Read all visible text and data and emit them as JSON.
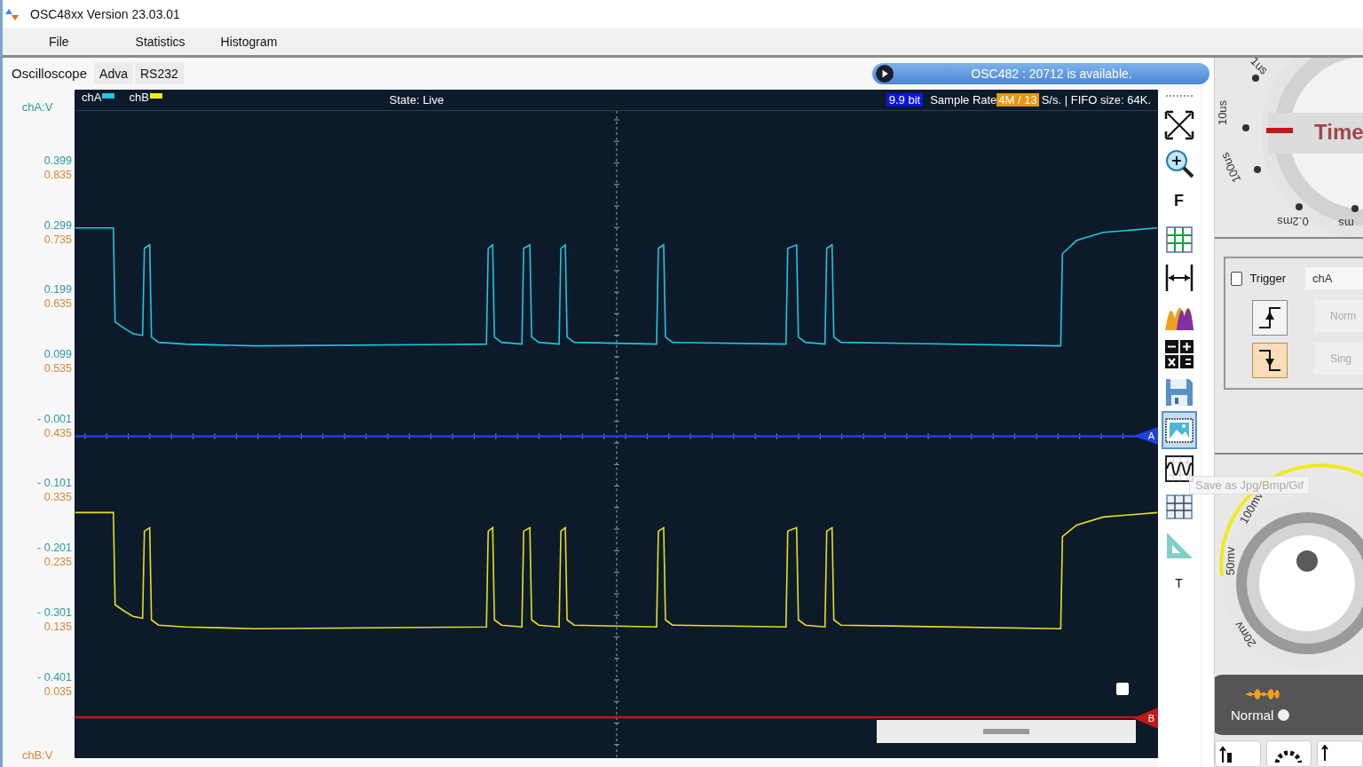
{
  "window": {
    "title": "OSC48xx  Version 23.03.01"
  },
  "menu": [
    "File",
    "Statistics",
    "Histogram"
  ],
  "tabs": [
    {
      "label": "Oscilloscope",
      "selected": true
    },
    {
      "label": "Adva",
      "selected": false
    },
    {
      "label": "RS232",
      "selected": false
    }
  ],
  "banner": {
    "text": "OSC482 : 20712 is available."
  },
  "plot": {
    "legend": [
      {
        "label": "chA",
        "color": "#1ec8dc"
      },
      {
        "label": "chB",
        "color": "#f0e81e"
      }
    ],
    "state": "State: Live",
    "resolution": "9.9 bit",
    "sample_rate_label": "Sample Rate",
    "sample_rate_value": "4M / 13",
    "sample_rate_suffix": "S/s. | FIFO size: 64K.",
    "markers": [
      {
        "label": "A",
        "color": "#2040e0"
      },
      {
        "label": "B",
        "color": "#c01818"
      }
    ]
  },
  "axis": {
    "top_label": "chA:V",
    "bottom_label": "chB:V",
    "ticks": [
      {
        "a": "0.399",
        "b": "0.835"
      },
      {
        "a": "0.299",
        "b": "0.735"
      },
      {
        "a": "0.199",
        "b": "0.635"
      },
      {
        "a": "0.099",
        "b": "0.535"
      },
      {
        "a": "- 0.001",
        "b": "0.435"
      },
      {
        "a": "- 0.101",
        "b": "0.335"
      },
      {
        "a": "- 0.201",
        "b": "0.235"
      },
      {
        "a": "- 0.301",
        "b": "0.135"
      },
      {
        "a": "- 0.401",
        "b": "0.035"
      }
    ]
  },
  "toolbar": [
    {
      "kind": "fit",
      "selected": false
    },
    {
      "kind": "zoom",
      "selected": false
    },
    {
      "kind": "text",
      "label": "F",
      "selected": false
    },
    {
      "kind": "grid",
      "selected": false
    },
    {
      "kind": "span",
      "selected": false
    },
    {
      "kind": "histogram",
      "selected": false
    },
    {
      "kind": "math",
      "selected": false
    },
    {
      "kind": "save",
      "selected": false
    },
    {
      "kind": "image",
      "selected": true
    },
    {
      "kind": "wave",
      "selected": false
    },
    {
      "kind": "table",
      "selected": false
    },
    {
      "kind": "ruler",
      "selected": false
    },
    {
      "kind": "text",
      "label": "T",
      "selected": false
    }
  ],
  "tooltip": "Save as Jpg/Bmp/Gif",
  "time_knob": {
    "label": "Time",
    "scale": [
      "1us",
      "10us",
      "100us",
      "0.2ms",
      "ms"
    ]
  },
  "trigger": {
    "label": "Trigger",
    "checked": false,
    "source": "chA",
    "edges": [
      {
        "kind": "rising",
        "selected": false
      },
      {
        "kind": "falling",
        "selected": true
      }
    ],
    "buttons": [
      "Norm",
      "Sing"
    ]
  },
  "volt_knob": {
    "scale": [
      "100mv",
      "50mv",
      "20mv"
    ]
  },
  "mode": {
    "label": "Normal"
  }
}
